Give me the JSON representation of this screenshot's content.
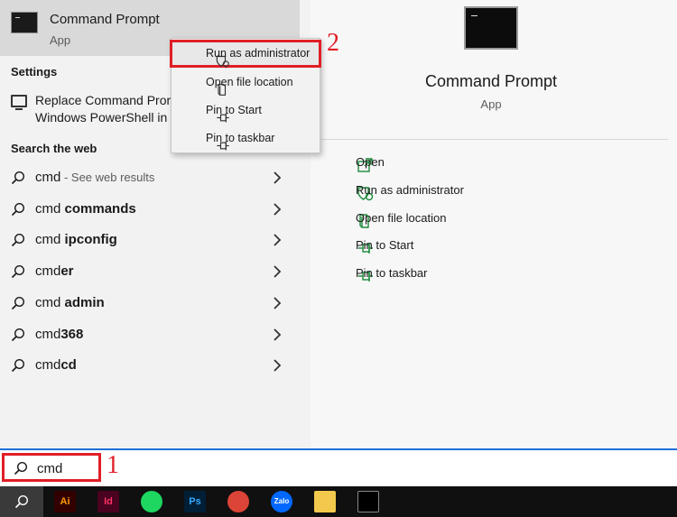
{
  "best_match": {
    "title": "Command Prompt",
    "subtitle": "App"
  },
  "sections": {
    "settings": "Settings",
    "search_web": "Search the web"
  },
  "settings_item": {
    "line1": "Replace Command Pror",
    "line2": "Windows PowerShell in"
  },
  "web_results": [
    {
      "plain": "cmd",
      "bold": "",
      "suffix": " - See web results"
    },
    {
      "plain": "cmd ",
      "bold": "commands",
      "suffix": ""
    },
    {
      "plain": "cmd ",
      "bold": "ipconfig",
      "suffix": ""
    },
    {
      "plain": "cmd",
      "bold": "er",
      "suffix": ""
    },
    {
      "plain": "cmd ",
      "bold": "admin",
      "suffix": ""
    },
    {
      "plain": "cmd",
      "bold": "368",
      "suffix": ""
    },
    {
      "plain": "cmd",
      "bold": "cd",
      "suffix": ""
    }
  ],
  "context_menu": [
    {
      "label": "Run as administrator",
      "icon": "shield-icon"
    },
    {
      "label": "Open file location",
      "icon": "folder-icon"
    },
    {
      "label": "Pin to Start",
      "icon": "pin-icon"
    },
    {
      "label": "Pin to taskbar",
      "icon": "pin-icon"
    }
  ],
  "detail": {
    "title": "Command Prompt",
    "subtitle": "App",
    "actions": [
      {
        "label": "Open",
        "icon": "open-icon"
      },
      {
        "label": "Run as administrator",
        "icon": "shield-icon"
      },
      {
        "label": "Open file location",
        "icon": "folder-icon"
      },
      {
        "label": "Pin to Start",
        "icon": "pin-icon"
      },
      {
        "label": "Pin to taskbar",
        "icon": "pin-icon"
      }
    ]
  },
  "search": {
    "value": "cmd"
  },
  "annotations": {
    "step1": "1",
    "step2": "2"
  },
  "taskbar": [
    {
      "name": "illustrator",
      "label": "Ai",
      "bg": "#330000",
      "fg": "#ff9a00"
    },
    {
      "name": "indesign",
      "label": "Id",
      "bg": "#49021f",
      "fg": "#ff3366"
    },
    {
      "name": "spotify",
      "label": "",
      "bg": "#1ed760",
      "fg": "#000000"
    },
    {
      "name": "photoshop",
      "label": "Ps",
      "bg": "#001e36",
      "fg": "#31a8ff"
    },
    {
      "name": "chrome",
      "label": "",
      "bg": "#db4437",
      "fg": "#ffffff"
    },
    {
      "name": "zalo",
      "label": "Zalo",
      "bg": "#0068ff",
      "fg": "#ffffff"
    },
    {
      "name": "file-explorer",
      "label": "",
      "bg": "#f2c94c",
      "fg": "#000000"
    },
    {
      "name": "command-prompt",
      "label": "",
      "bg": "#000000",
      "fg": "#ffffff"
    }
  ],
  "colors": {
    "accent_blue": "#1e6fd9",
    "annotation_red": "#e01e26",
    "action_green": "#1b8a3a"
  }
}
